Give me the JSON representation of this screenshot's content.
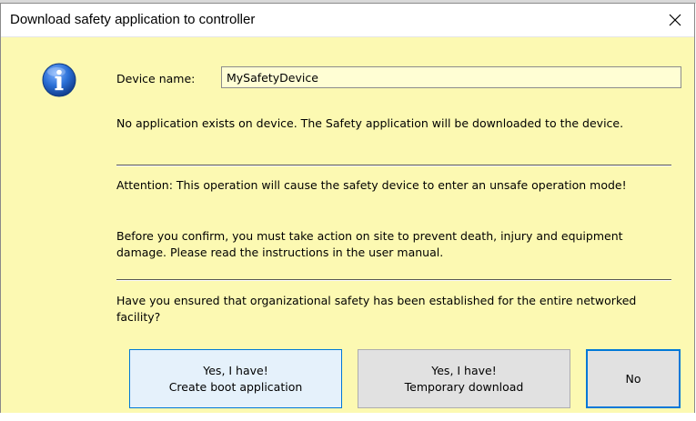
{
  "dialog": {
    "title": "Download safety application to controller",
    "close_icon": "close-icon",
    "info_icon": "info-icon",
    "device_label": "Device name:",
    "device_value": "MySafetyDevice",
    "message_no_app": "No application exists on device. The Safety application will be downloaded to the device.",
    "message_attention": "Attention: This operation will cause the safety device to enter an unsafe operation mode!",
    "message_confirm": "Before you confirm, you must take action on site to prevent death, injury and equipment damage. Please read the instructions in the user manual.",
    "message_question": "Have you ensured that organizational safety has been established for the entire networked facility?",
    "buttons": {
      "yes_boot_line1": "Yes, I have!",
      "yes_boot_line2": "Create boot application",
      "yes_temp_line1": "Yes, I have!",
      "yes_temp_line2": "Temporary download",
      "no": "No"
    }
  },
  "colors": {
    "body_background": "#fcf9b2",
    "accent": "#0078d7",
    "info_icon": "#1e62c8"
  }
}
